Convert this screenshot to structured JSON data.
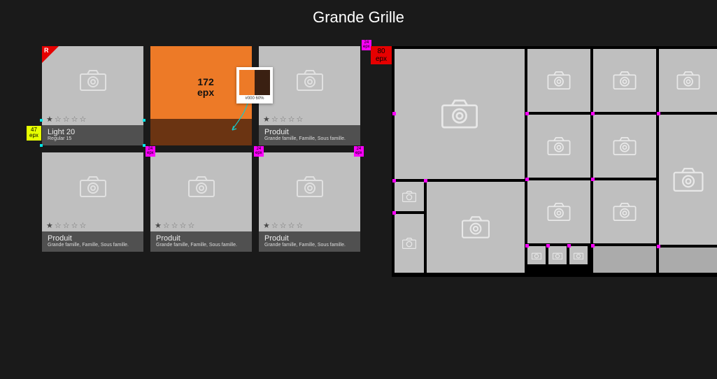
{
  "title": "Grande Grille",
  "annotations": {
    "r_badge": "R",
    "left_yellow": "47\nepx",
    "top_red": "80\nepx",
    "gap_magenta": "24\nepx",
    "swatch_label": "#000 60%",
    "orange_measure": "172\nepx"
  },
  "colors": {
    "orange": "#ed7a27",
    "orange_dark": "#6b3412",
    "swatch_light": "#ed7a27",
    "swatch_dark": "#3a2012"
  },
  "tiles": [
    {
      "title": "Light 20",
      "sub": "Regular 15",
      "rating": 1
    },
    {
      "title": "",
      "sub": "",
      "rating": 0
    },
    {
      "title": "Produit",
      "sub": "Grande famille, Famille, Sous famille.",
      "rating": 1
    },
    {
      "title": "Produit",
      "sub": "Grande famille, Famille, Sous famille.",
      "rating": 1
    },
    {
      "title": "Produit",
      "sub": "Grande famille, Famille, Sous famille.",
      "rating": 1
    },
    {
      "title": "Produit",
      "sub": "Grande famille, Famille, Sous famille.",
      "rating": 1
    }
  ]
}
